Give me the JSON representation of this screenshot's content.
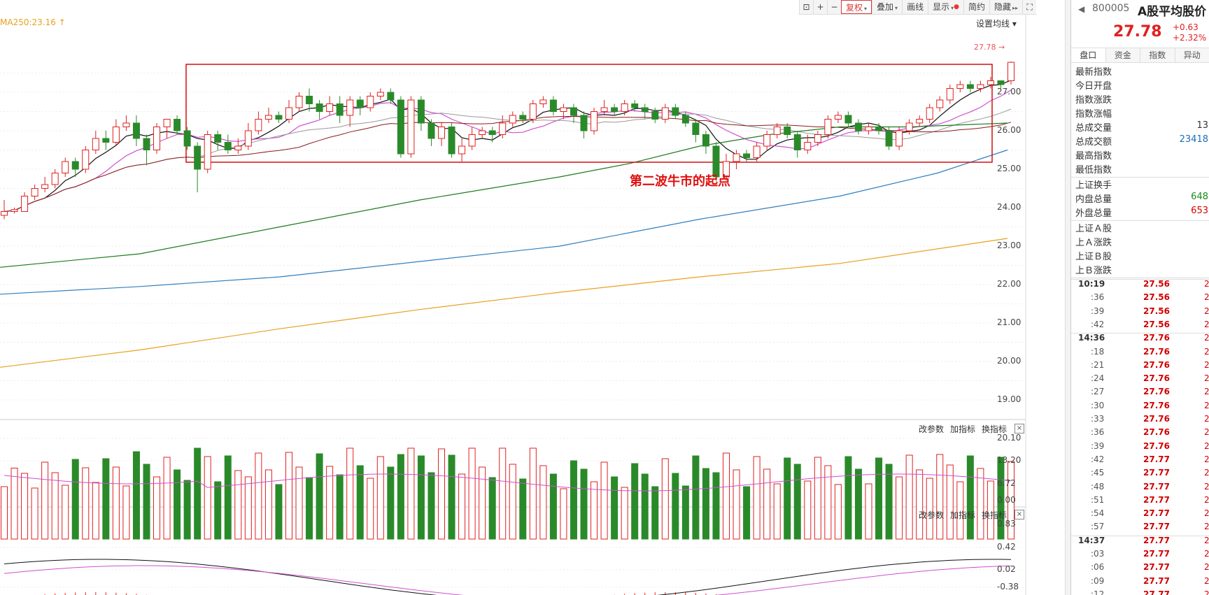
{
  "toolbar": {
    "buttons": [
      "复权",
      "叠加",
      "画线",
      "显示",
      "简约",
      "隐藏"
    ]
  },
  "ma250_label": "MA250:23.16",
  "set_ma_label": "设置均线",
  "last_price_tag": "27.78",
  "annotation": "第二波牛市的起点",
  "price_axis": [
    "27.00",
    "26.00",
    "25.00",
    "24.00",
    "23.00",
    "22.00",
    "21.00",
    "20.00",
    "19.00"
  ],
  "volume_panel": {
    "buttons": [
      "改参数",
      "加指标",
      "换指标"
    ],
    "axis": [
      "20.10",
      "13.20",
      "6.72",
      "0.00"
    ]
  },
  "macd_panel": {
    "buttons": [
      "改参数",
      "加指标",
      "换指标"
    ],
    "axis": [
      "0.83",
      "0.42",
      "0.02",
      "-0.38"
    ]
  },
  "close_glyph": "×",
  "panel": {
    "code": "800005",
    "name": "A股平均股价",
    "price": "27.78",
    "change": "+0.63",
    "change_pct": "+2.32%",
    "tabs": [
      "盘口",
      "资金",
      "指数",
      "异动"
    ],
    "rows": [
      {
        "label": "最新指数",
        "value": ""
      },
      {
        "label": "今日开盘",
        "value": ""
      },
      {
        "label": "指数涨跌",
        "value": ""
      },
      {
        "label": "指数涨幅",
        "value": ""
      },
      {
        "label": "总成交量",
        "value": "13"
      },
      {
        "label": "总成交额",
        "value": "23418"
      },
      {
        "label": "最高指数",
        "value": ""
      },
      {
        "label": "最低指数",
        "value": ""
      }
    ],
    "rows2": [
      {
        "label": "上证换手",
        "value": ""
      },
      {
        "label": "内盘总量",
        "value": "648"
      },
      {
        "label": "外盘总量",
        "value": "653"
      }
    ],
    "rows3": [
      {
        "label": "上证Ａ股"
      },
      {
        "label": "上Ａ涨跌"
      },
      {
        "label": "上证Ｂ股"
      },
      {
        "label": "上Ｂ涨跌"
      }
    ],
    "ticks": [
      {
        "time": "10:19",
        "price": "27.56",
        "sub": false,
        "x": "2"
      },
      {
        "time": ":36",
        "price": "27.56",
        "sub": true,
        "x": "2"
      },
      {
        "time": ":39",
        "price": "27.56",
        "sub": true,
        "x": "2"
      },
      {
        "time": ":42",
        "price": "27.56",
        "sub": true,
        "x": "2"
      },
      {
        "time": "14:36",
        "price": "27.76",
        "sub": false,
        "x": "2"
      },
      {
        "time": ":18",
        "price": "27.76",
        "sub": true,
        "x": "2"
      },
      {
        "time": ":21",
        "price": "27.76",
        "sub": true,
        "x": "2"
      },
      {
        "time": ":24",
        "price": "27.76",
        "sub": true,
        "x": "2"
      },
      {
        "time": ":27",
        "price": "27.76",
        "sub": true,
        "x": "2"
      },
      {
        "time": ":30",
        "price": "27.76",
        "sub": true,
        "x": "2"
      },
      {
        "time": ":33",
        "price": "27.76",
        "sub": true,
        "x": "2"
      },
      {
        "time": ":36",
        "price": "27.76",
        "sub": true,
        "x": "2"
      },
      {
        "time": ":39",
        "price": "27.76",
        "sub": true,
        "x": "2"
      },
      {
        "time": ":42",
        "price": "27.77",
        "sub": true,
        "x": "2"
      },
      {
        "time": ":45",
        "price": "27.77",
        "sub": true,
        "x": "2"
      },
      {
        "time": ":48",
        "price": "27.77",
        "sub": true,
        "x": "2"
      },
      {
        "time": ":51",
        "price": "27.77",
        "sub": true,
        "x": "2"
      },
      {
        "time": ":54",
        "price": "27.77",
        "sub": true,
        "x": "2"
      },
      {
        "time": ":57",
        "price": "27.77",
        "sub": true,
        "x": "2"
      },
      {
        "time": "14:37",
        "price": "27.77",
        "sub": false,
        "x": "2"
      },
      {
        "time": ":03",
        "price": "27.77",
        "sub": true,
        "x": "2"
      },
      {
        "time": ":06",
        "price": "27.77",
        "sub": true,
        "x": "2"
      },
      {
        "time": ":09",
        "price": "27.77",
        "sub": true,
        "x": "2"
      },
      {
        "time": ":12",
        "price": "27.77",
        "sub": true,
        "x": "2"
      }
    ]
  },
  "colors": {
    "up": "#e02020",
    "down": "#2a8a2a",
    "ma5": "#111111",
    "ma10": "#d050d0",
    "ma20": "#999999",
    "ma30": "#8b1a1a",
    "ma60": "#1e7a1e",
    "ma120": "#2f7fbf",
    "ma250": "#e8a020",
    "box": "#d01010"
  },
  "chart_data": {
    "type": "candlestick",
    "y_range": [
      18.6,
      27.9
    ],
    "candles_sample": [
      [
        23.8,
        23.9,
        24.2,
        23.7
      ],
      [
        23.9,
        23.95,
        24.0,
        23.85
      ],
      [
        23.9,
        24.3,
        24.4,
        23.9
      ],
      [
        24.3,
        24.5,
        24.6,
        24.2
      ],
      [
        24.5,
        24.6,
        24.8,
        24.4
      ],
      [
        24.6,
        24.9,
        25.0,
        24.5
      ],
      [
        24.9,
        25.2,
        25.3,
        24.8
      ],
      [
        25.2,
        25.0,
        25.3,
        24.8
      ],
      [
        25.0,
        25.5,
        25.6,
        24.9
      ],
      [
        25.5,
        25.8,
        26.0,
        25.4
      ],
      [
        25.8,
        25.7,
        26.0,
        25.5
      ],
      [
        25.7,
        26.1,
        26.3,
        25.6
      ],
      [
        26.1,
        26.2,
        26.4,
        26.0
      ],
      [
        26.2,
        25.8,
        26.4,
        25.6
      ],
      [
        25.8,
        25.5,
        25.9,
        25.1
      ],
      [
        25.5,
        26.1,
        26.2,
        25.4
      ],
      [
        26.1,
        26.3,
        26.3,
        25.8
      ],
      [
        26.3,
        26.0,
        26.4,
        25.9
      ],
      [
        26.0,
        25.6,
        26.1,
        25.5
      ],
      [
        25.6,
        25.0,
        25.7,
        24.4
      ],
      [
        25.0,
        25.9,
        26.0,
        24.9
      ],
      [
        25.9,
        25.7,
        26.0,
        25.5
      ],
      [
        25.7,
        25.5,
        25.9,
        25.4
      ],
      [
        25.5,
        25.6,
        25.8,
        25.4
      ],
      [
        25.6,
        26.0,
        26.2,
        25.5
      ],
      [
        26.0,
        26.3,
        26.5,
        25.9
      ],
      [
        26.3,
        26.4,
        26.6,
        26.2
      ],
      [
        26.4,
        26.3,
        26.5,
        26.2
      ],
      [
        26.3,
        26.6,
        26.8,
        26.2
      ],
      [
        26.6,
        26.9,
        27.0,
        26.5
      ],
      [
        26.9,
        26.7,
        27.1,
        26.5
      ],
      [
        26.7,
        26.5,
        26.8,
        26.3
      ],
      [
        26.5,
        26.7,
        26.9,
        26.4
      ],
      [
        26.7,
        26.4,
        26.9,
        26.2
      ],
      [
        26.4,
        26.8,
        26.9,
        26.1
      ],
      [
        26.8,
        26.6,
        26.9,
        26.4
      ],
      [
        26.6,
        26.9,
        27.0,
        26.5
      ],
      [
        26.9,
        27.0,
        27.1,
        26.8
      ],
      [
        27.0,
        26.8,
        27.1,
        26.7
      ],
      [
        26.8,
        25.4,
        26.9,
        25.3
      ],
      [
        25.4,
        26.8,
        26.9,
        25.3
      ],
      [
        26.8,
        26.2,
        26.9,
        26.0
      ],
      [
        26.2,
        25.8,
        26.3,
        25.6
      ],
      [
        25.8,
        26.1,
        26.2,
        25.6
      ],
      [
        26.1,
        25.4,
        26.2,
        25.3
      ],
      [
        25.4,
        25.6,
        25.8,
        25.2
      ],
      [
        25.6,
        25.9,
        26.1,
        25.5
      ],
      [
        25.9,
        26.0,
        26.1,
        25.8
      ],
      [
        26.0,
        25.9,
        26.1,
        25.7
      ],
      [
        25.9,
        26.2,
        26.4,
        25.8
      ],
      [
        26.2,
        26.4,
        26.5,
        26.1
      ],
      [
        26.4,
        26.3,
        26.5,
        26.2
      ],
      [
        26.3,
        26.7,
        26.8,
        26.2
      ],
      [
        26.7,
        26.8,
        26.9,
        26.6
      ],
      [
        26.8,
        26.5,
        26.9,
        26.4
      ],
      [
        26.5,
        26.6,
        26.7,
        26.3
      ],
      [
        26.6,
        26.4,
        26.7,
        26.2
      ],
      [
        26.4,
        26.0,
        26.5,
        25.8
      ],
      [
        26.0,
        26.5,
        26.6,
        25.9
      ],
      [
        26.5,
        26.6,
        26.8,
        26.4
      ],
      [
        26.6,
        26.5,
        26.7,
        26.4
      ],
      [
        26.5,
        26.7,
        26.8,
        26.4
      ],
      [
        26.7,
        26.6,
        26.8,
        26.5
      ],
      [
        26.6,
        26.5,
        26.7,
        26.3
      ],
      [
        26.5,
        26.3,
        26.6,
        26.2
      ],
      [
        26.3,
        26.6,
        26.7,
        26.2
      ],
      [
        26.6,
        26.4,
        26.7,
        26.3
      ],
      [
        26.4,
        26.2,
        26.5,
        26.1
      ],
      [
        26.2,
        25.9,
        26.3,
        25.7
      ],
      [
        25.9,
        25.6,
        26.0,
        25.4
      ],
      [
        25.6,
        24.8,
        25.7,
        24.7
      ],
      [
        24.8,
        25.2,
        25.4,
        24.7
      ],
      [
        25.2,
        25.4,
        25.5,
        25.0
      ],
      [
        25.4,
        25.3,
        25.5,
        25.2
      ],
      [
        25.3,
        25.6,
        25.7,
        25.2
      ],
      [
        25.6,
        25.9,
        26.0,
        25.5
      ],
      [
        25.9,
        26.1,
        26.2,
        25.8
      ],
      [
        26.1,
        25.9,
        26.2,
        25.8
      ],
      [
        25.9,
        25.5,
        26.0,
        25.3
      ],
      [
        25.5,
        25.7,
        25.9,
        25.4
      ],
      [
        25.7,
        25.9,
        26.0,
        25.6
      ],
      [
        25.9,
        26.3,
        26.4,
        25.8
      ],
      [
        26.3,
        26.4,
        26.5,
        26.2
      ],
      [
        26.4,
        26.2,
        26.5,
        26.1
      ],
      [
        26.2,
        26.0,
        26.3,
        25.9
      ],
      [
        26.0,
        26.1,
        26.2,
        25.9
      ],
      [
        26.1,
        26.0,
        26.2,
        25.9
      ],
      [
        26.0,
        25.6,
        26.1,
        25.5
      ],
      [
        25.6,
        26.0,
        26.1,
        25.5
      ],
      [
        26.0,
        26.2,
        26.3,
        25.9
      ],
      [
        26.2,
        26.3,
        26.4,
        26.1
      ],
      [
        26.3,
        26.6,
        26.7,
        26.2
      ],
      [
        26.6,
        26.8,
        26.9,
        26.5
      ],
      [
        26.8,
        27.1,
        27.2,
        26.7
      ],
      [
        27.1,
        27.2,
        27.3,
        27.0
      ],
      [
        27.2,
        27.1,
        27.3,
        27.0
      ],
      [
        27.1,
        27.2,
        27.3,
        27.0
      ],
      [
        27.2,
        27.3,
        27.4,
        27.1
      ],
      [
        27.3,
        27.2,
        27.3,
        27.1
      ],
      [
        27.3,
        27.78,
        27.8,
        27.2
      ]
    ]
  }
}
